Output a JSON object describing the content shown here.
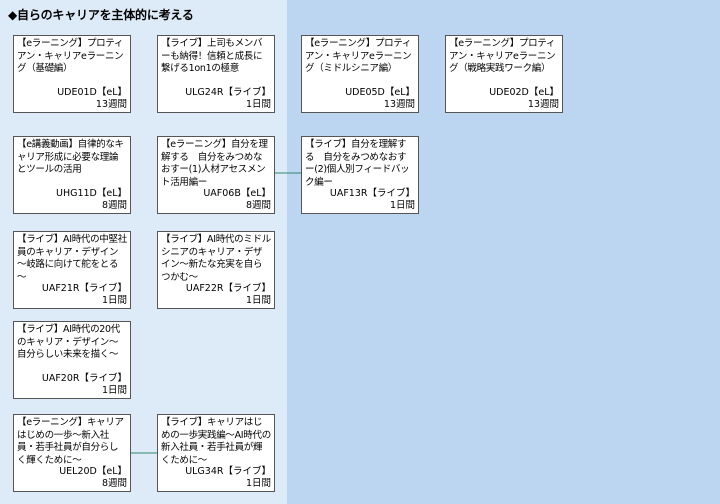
{
  "title": "◆自らのキャリアを主体的に考える",
  "colors": {
    "left_panel": "#ddeaf8",
    "right_panel": "#bcd5f0",
    "card_border": "#555555",
    "connector": "#2e8b6e"
  },
  "cards": [
    {
      "name": "【eラーニング】プロティアン・キャリアeラーニング（基礎編）",
      "code": "UDE01D【eL】",
      "duration": "13週間"
    },
    {
      "name": "【ライブ】上司もメンバーも納得！信頼と成長に繋げる1on1の極意",
      "code": "ULG24R【ライブ】",
      "duration": "1日間"
    },
    {
      "name": "【eラーニング】プロティアン・キャリアeラーニング（ミドルシニア編）",
      "code": "UDE05D【eL】",
      "duration": "13週間"
    },
    {
      "name": "【eラーニング】プロティアン・キャリアeラーニング（戦略実践ワーク編）",
      "code": "UDE02D【eL】",
      "duration": "13週間"
    },
    {
      "name": "【e講義動画】自律的なキャリア形成に必要な理論とツールの活用",
      "code": "UHG11D【eL】",
      "duration": "8週間"
    },
    {
      "name": "【eラーニング】自分を理解する　自分をみつめなおすー(1)人材アセスメント活用編ー",
      "code": "UAF06B【eL】",
      "duration": "8週間"
    },
    {
      "name": "【ライブ】自分を理解する　自分をみつめなおすー(2)個人別フィードバック編ー",
      "code": "UAF13R【ライブ】",
      "duration": "1日間"
    },
    {
      "name": "【ライブ】AI時代の中堅社員のキャリア・デザイン～岐路に向けて舵をとる～",
      "code": "UAF21R【ライブ】",
      "duration": "1日間"
    },
    {
      "name": "【ライブ】AI時代のミドルシニアのキャリア・デザイン～新たな充実を自らつかむ～",
      "code": "UAF22R【ライブ】",
      "duration": "1日間"
    },
    {
      "name": "【ライブ】AI時代の20代のキャリア・デザイン～自分らしい未来を描く～",
      "code": "UAF20R【ライブ】",
      "duration": "1日間"
    },
    {
      "name": "【eラーニング】キャリアはじめの一歩～新入社員・若手社員が自分らしく輝くために～",
      "code": "UEL20D【eL】",
      "duration": "8週間"
    },
    {
      "name": "【ライブ】キャリアはじめの一歩実践編～AI時代の新入社員・若手社員が輝くために～",
      "code": "ULG34R【ライブ】",
      "duration": "1日間"
    }
  ]
}
